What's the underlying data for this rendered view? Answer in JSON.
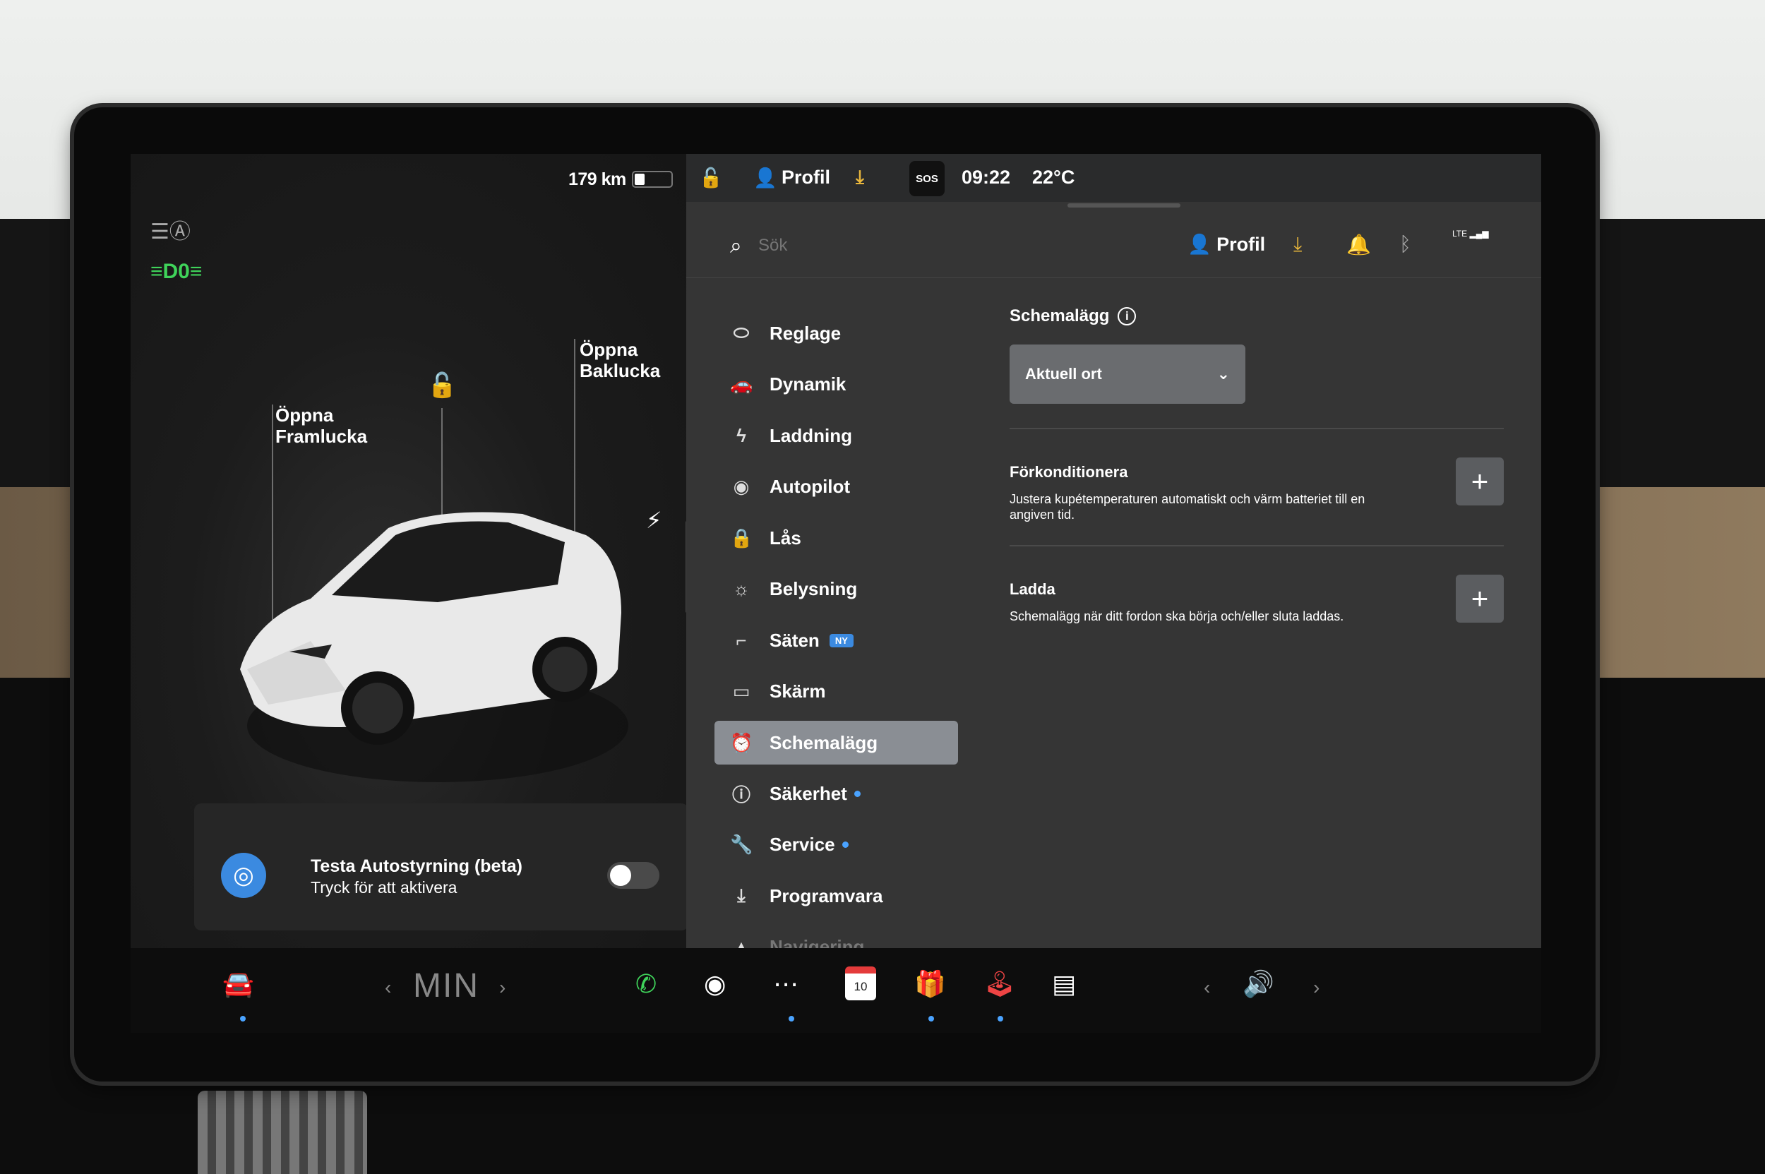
{
  "left": {
    "range": "179 km",
    "front_trunk": "Öppna\nFramlucka",
    "rear_trunk": "Öppna\nBaklucka",
    "autosteer_title": "Testa Autostyrning (beta)",
    "autosteer_sub": "Tryck för att aktivera"
  },
  "status": {
    "profile": "Profil",
    "sos": "SOS",
    "time": "09:22",
    "temp": "22°C"
  },
  "header": {
    "search_placeholder": "Sök",
    "profile": "Profil",
    "lte": "LTE"
  },
  "menu": [
    {
      "label": "Reglage",
      "icon": "toggle-icon"
    },
    {
      "label": "Dynamik",
      "icon": "car-icon"
    },
    {
      "label": "Laddning",
      "icon": "bolt-icon"
    },
    {
      "label": "Autopilot",
      "icon": "steering-wheel-icon"
    },
    {
      "label": "Lås",
      "icon": "lock-icon"
    },
    {
      "label": "Belysning",
      "icon": "sun-icon"
    },
    {
      "label": "Säten",
      "icon": "seat-icon",
      "badge": "NY"
    },
    {
      "label": "Skärm",
      "icon": "display-icon"
    },
    {
      "label": "Schemalägg",
      "icon": "alarm-clock-icon",
      "active": true
    },
    {
      "label": "Säkerhet",
      "icon": "info-circle-icon"
    },
    {
      "label": "Service",
      "icon": "wrench-icon"
    },
    {
      "label": "Programvara",
      "icon": "download-icon"
    },
    {
      "label": "Navigering",
      "icon": "navigation-icon"
    }
  ],
  "content": {
    "title": "Schemalägg",
    "dropdown_value": "Aktuell ort",
    "precondition_title": "Förkonditionera",
    "precondition_desc": "Justera kupétemperaturen automatiskt och värm batteriet till en angiven tid.",
    "charge_title": "Ladda",
    "charge_desc": "Schemalägg när ditt fordon ska börja och/eller sluta laddas."
  },
  "bottom": {
    "temp_display": "MIN",
    "calendar_day": "10"
  },
  "colors": {
    "accent_blue": "#3b8ae0",
    "download_yellow": "#e8b63c",
    "light_green": "#3fd35a",
    "active_menu": "#8a8e94"
  }
}
